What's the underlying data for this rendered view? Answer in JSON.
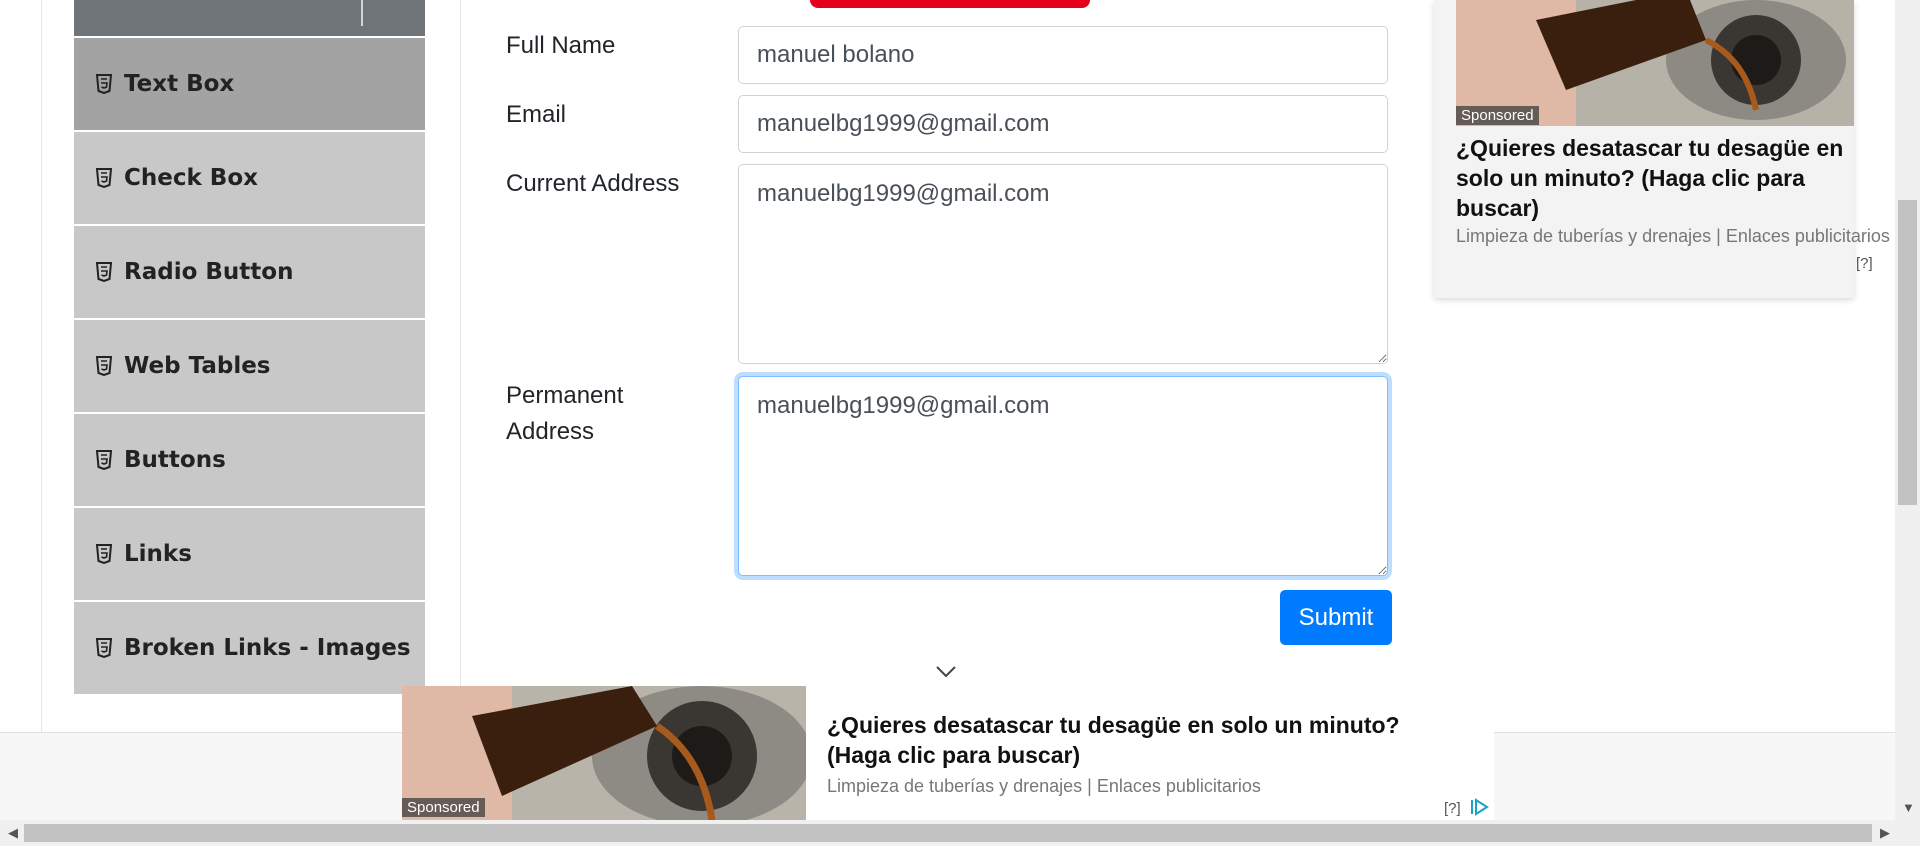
{
  "sidebar": {
    "items": [
      {
        "label": "Text Box",
        "active": true
      },
      {
        "label": "Check Box",
        "active": false
      },
      {
        "label": "Radio Button",
        "active": false
      },
      {
        "label": "Web Tables",
        "active": false
      },
      {
        "label": "Buttons",
        "active": false
      },
      {
        "label": "Links",
        "active": false
      },
      {
        "label": "Broken Links - Images",
        "active": false
      }
    ]
  },
  "form": {
    "full_name_label": "Full Name",
    "full_name_value": "manuel bolano",
    "email_label": "Email",
    "email_value": "manuelbg1999@gmail.com",
    "current_address_label": "Current Address",
    "current_address_value": "manuelbg1999@gmail.com",
    "permanent_address_label_line1": "Permanent",
    "permanent_address_label_line2": "Address",
    "permanent_address_value": "manuelbg1999@gmail.com",
    "submit_label": "Submit"
  },
  "ad_side": {
    "sponsored": "Sponsored",
    "title": "¿Quieres desatascar tu desagüe en solo un minuto? (Haga clic para buscar)",
    "subtitle": "Limpieza de tuberías y drenajes | Enlaces publicitarios",
    "help": "[?]"
  },
  "ad_bottom": {
    "sponsored": "Sponsored",
    "title_line1": "¿Quieres desatascar tu desagüe en solo un minuto?",
    "title_line2": "(Haga clic para buscar)",
    "subtitle": "Limpieza de tuberías y drenajes | Enlaces publicitarios",
    "help": "[?]"
  },
  "colors": {
    "accent": "#007bff",
    "sidebar_active": "#a3a3a3",
    "sidebar_item": "#c8c8c8",
    "ad_icon": "#1ba1c6"
  }
}
